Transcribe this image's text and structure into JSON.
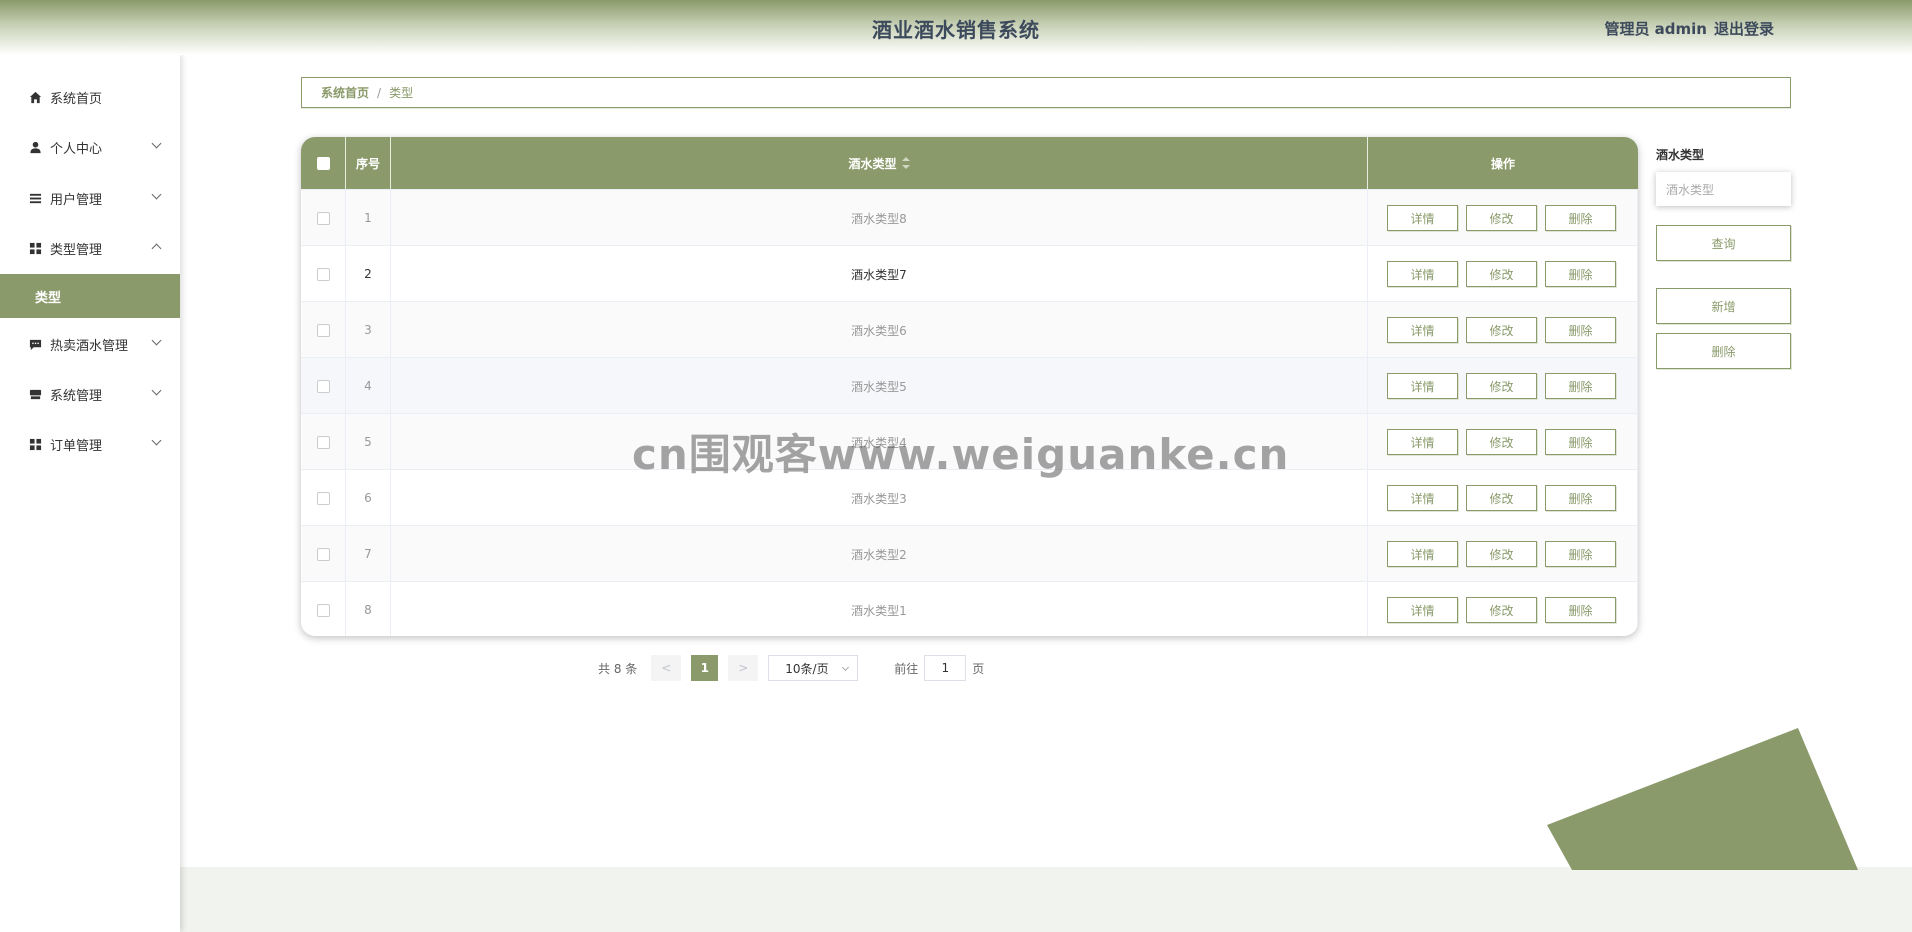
{
  "header": {
    "title": "酒业酒水销售系统",
    "user": "管理员 admin",
    "logout": "退出登录"
  },
  "sidebar": {
    "items": [
      {
        "label": "系统首页",
        "icon": "home-icon"
      },
      {
        "label": "个人中心",
        "icon": "user-icon"
      },
      {
        "label": "用户管理",
        "icon": "list-icon"
      },
      {
        "label": "类型管理",
        "icon": "grid-icon"
      },
      {
        "label": "热卖酒水管理",
        "icon": "chat-icon"
      },
      {
        "label": "系统管理",
        "icon": "store-icon"
      },
      {
        "label": "订单管理",
        "icon": "grid-icon"
      }
    ],
    "active_sub": "类型"
  },
  "breadcrumb": {
    "home": "系统首页",
    "separator": "/",
    "current": "类型"
  },
  "table": {
    "headers": {
      "no": "序号",
      "type": "酒水类型",
      "op": "操作"
    },
    "rows": [
      {
        "no": "1",
        "type": "酒水类型8"
      },
      {
        "no": "2",
        "type": "酒水类型7"
      },
      {
        "no": "3",
        "type": "酒水类型6"
      },
      {
        "no": "4",
        "type": "酒水类型5"
      },
      {
        "no": "5",
        "type": "酒水类型4"
      },
      {
        "no": "6",
        "type": "酒水类型3"
      },
      {
        "no": "7",
        "type": "酒水类型2"
      },
      {
        "no": "8",
        "type": "酒水类型1"
      }
    ],
    "actions": {
      "detail": "详情",
      "edit": "修改",
      "delete": "删除"
    }
  },
  "pager": {
    "total": "共 8 条",
    "prev": "<",
    "current": "1",
    "next": ">",
    "size": "10条/页",
    "goto_prefix": "前往",
    "goto_value": "1",
    "goto_suffix": "页"
  },
  "search": {
    "label": "酒水类型",
    "placeholder": "酒水类型",
    "query": "查询",
    "add": "新增",
    "delete": "删除"
  },
  "watermark": "cn围观客www.weiguanke.cn",
  "colors": {
    "accent": "#8a9a6a"
  }
}
